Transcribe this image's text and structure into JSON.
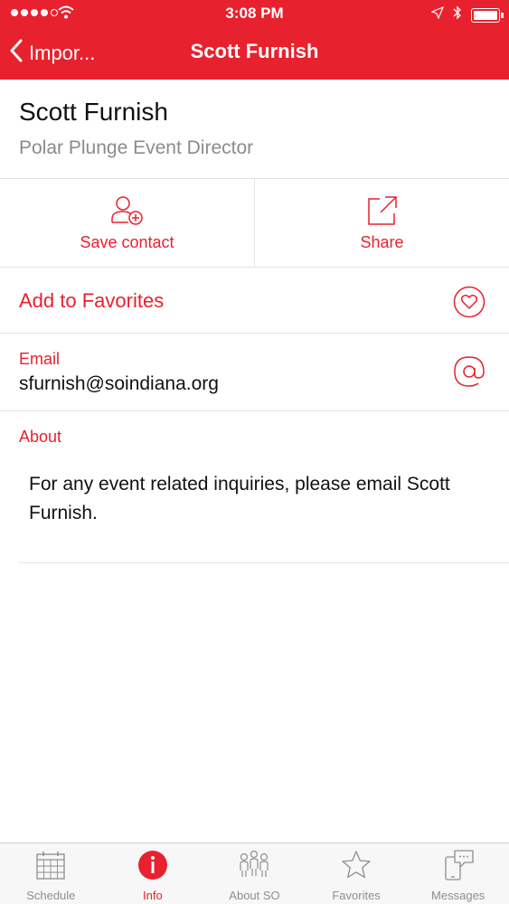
{
  "status_bar": {
    "time": "3:08 PM",
    "signal_icon": "signal-dots-icon",
    "wifi_icon": "wifi-icon",
    "location_icon": "location-arrow-icon",
    "bluetooth_icon": "bluetooth-icon",
    "battery_icon": "battery-icon",
    "battery_level": 1.0
  },
  "nav": {
    "back_label": "Impor...",
    "back_icon": "chevron-left-icon",
    "title": "Scott Furnish"
  },
  "contact": {
    "name": "Scott Furnish",
    "role": "Polar Plunge Event Director"
  },
  "actions": {
    "save_contact": {
      "label": "Save contact",
      "icon": "add-user-icon"
    },
    "share": {
      "label": "Share",
      "icon": "share-icon"
    }
  },
  "favorites": {
    "label": "Add to Favorites",
    "icon": "heart-icon"
  },
  "email": {
    "label": "Email",
    "value": "sfurnish@soindiana.org",
    "icon": "at-sign-icon"
  },
  "about": {
    "label": "About",
    "text": "For any event related inquiries, please email Scott Furnish."
  },
  "tabs": [
    {
      "label": "Schedule",
      "icon": "calendar-icon",
      "active": false
    },
    {
      "label": "Info",
      "icon": "info-icon",
      "active": true
    },
    {
      "label": "About SO",
      "icon": "people-icon",
      "active": false
    },
    {
      "label": "Favorites",
      "icon": "star-icon",
      "active": false
    },
    {
      "label": "Messages",
      "icon": "messages-icon",
      "active": false
    }
  ],
  "colors": {
    "accent": "#e8212e",
    "text": "#111111",
    "secondary_text": "#8b8b8b",
    "divider": "#e3e3e3",
    "tab_bar_bg": "#f7f7f7",
    "tab_inactive": "#8e8e8e"
  }
}
